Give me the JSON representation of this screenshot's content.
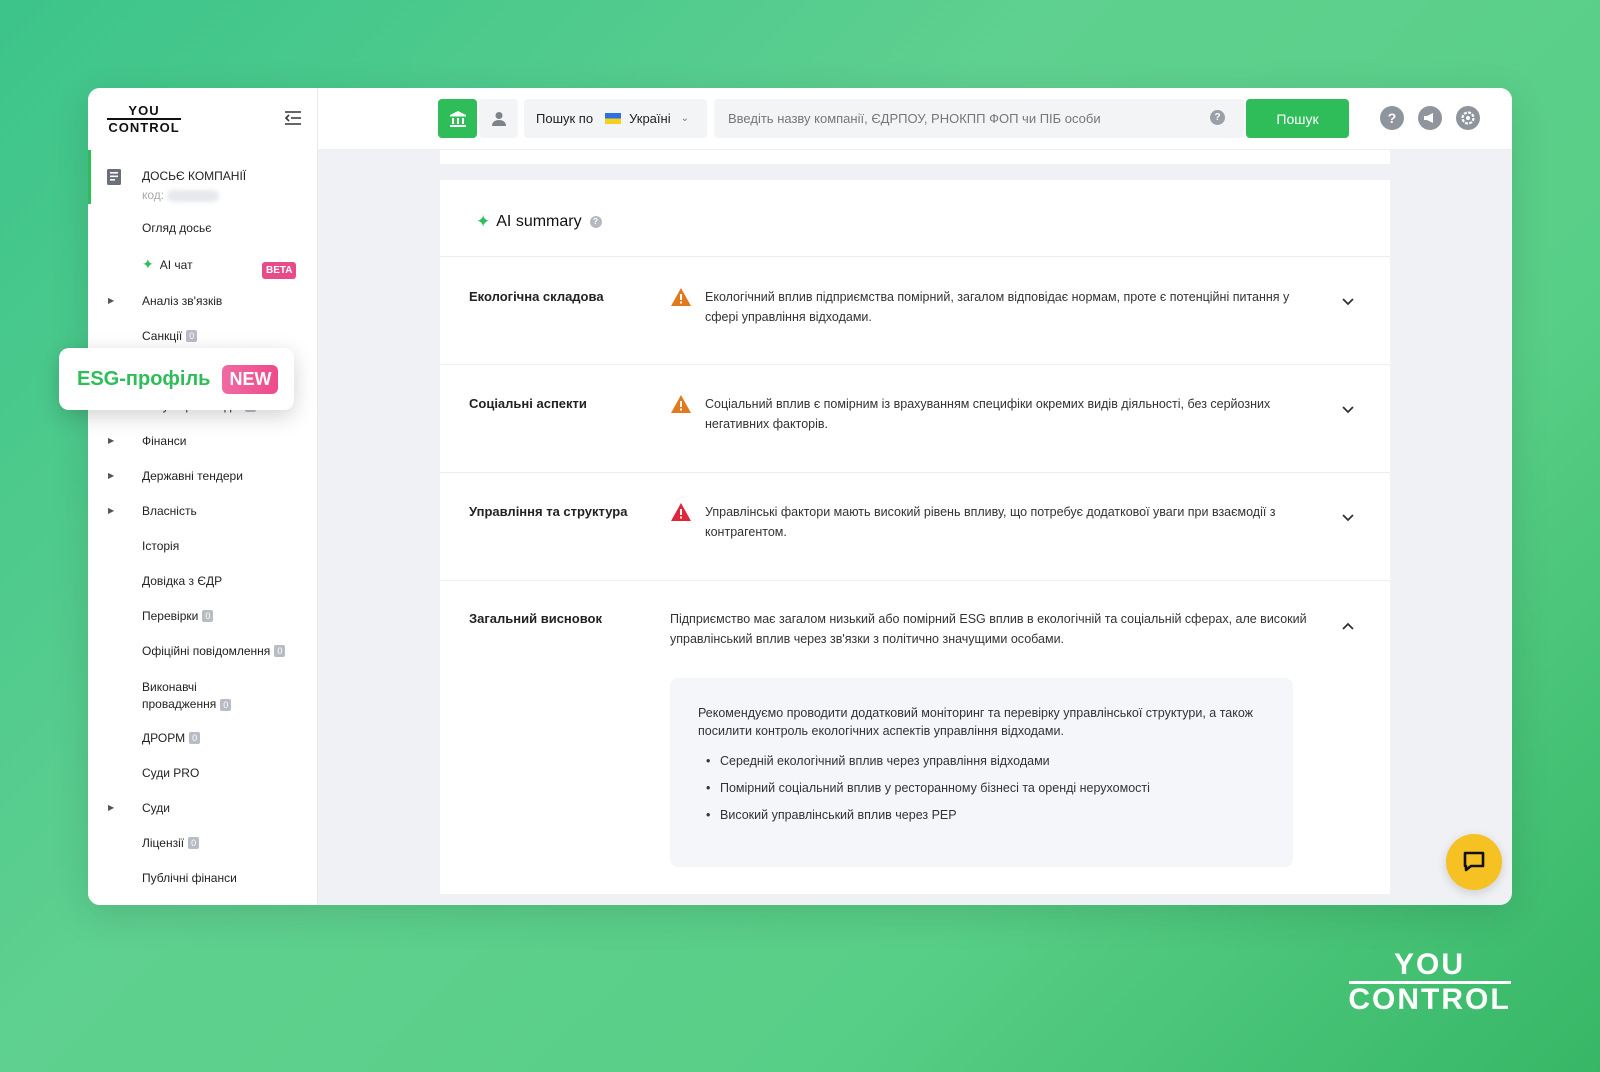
{
  "logo": {
    "line1": "YOU",
    "line2": "CONTROL"
  },
  "sidebar": {
    "dossier_title": "ДОСЬЄ КОМПАНІЇ",
    "dossier_code_label": "код:",
    "items": [
      {
        "label": "Огляд досьє",
        "count": null
      },
      {
        "label": "AI чат",
        "badge": "BETA"
      },
      {
        "label": "Аналіз зв'язків",
        "count": null
      },
      {
        "label": "Санкції",
        "count": "0"
      },
      {
        "label": "Репутація в медіа",
        "count": "0"
      },
      {
        "label": "Фінанси",
        "count": null
      },
      {
        "label": "Державні тендери",
        "count": null
      },
      {
        "label": "Власність",
        "count": null
      },
      {
        "label": "Історія",
        "count": null
      },
      {
        "label": "Довідка з ЄДР",
        "count": null
      },
      {
        "label": "Перевірки",
        "count": "0"
      },
      {
        "label": "Офіційні повідомлення",
        "count": "0"
      },
      {
        "label": "Виконавчі",
        "label2": "провадження",
        "count": "0"
      },
      {
        "label": "ДРОРМ",
        "count": "0"
      },
      {
        "label": "Суди PRO",
        "count": null
      },
      {
        "label": "Суди",
        "count": null
      },
      {
        "label": "Ліцензії",
        "count": "0"
      },
      {
        "label": "Публічні фінанси",
        "count": null
      }
    ]
  },
  "callout": {
    "label": "ESG-профіль",
    "badge": "NEW"
  },
  "header": {
    "scope_prefix": "Пошук по",
    "scope_value": "Україні",
    "search_placeholder": "Введіть назву компанії, ЄДРПОУ, РНОКПП ФОП чи ПІБ особи",
    "search_button": "Пошук"
  },
  "summary": {
    "title": "AI summary",
    "rows": [
      {
        "label": "Екологічна складова",
        "text": "Екологічний вплив підприємства помірний, загалом відповідає нормам, проте є потенційні питання у сфері управління відходами.",
        "level": "medium"
      },
      {
        "label": "Соціальні аспекти",
        "text": "Соціальний вплив є помірним із врахуванням специфіки окремих видів діяльності, без серйозних негативних факторів.",
        "level": "medium"
      },
      {
        "label": "Управління та структура",
        "text": "Управлінські фактори мають високий рівень впливу, що потребує додаткової уваги при взаємодії з контрагентом.",
        "level": "high"
      }
    ],
    "conclusion": {
      "label": "Загальний висновок",
      "text": "Підприємство має загалом низький або помірний ESG вплив в екологічній та соціальній сферах, але високий управлінський вплив через зв'язки з політично значущими особами.",
      "recommendation": "Рекомендуємо проводити додатковий моніторинг та перевірку управлінської структури, а також посилити контроль екологічних аспектів управління відходами.",
      "bullets": [
        "Середній екологічний вплив через управління відходами",
        "Помірний соціальний вплив у ресторанному бізнесі та оренді нерухомості",
        "Високий управлінський вплив через PEP"
      ]
    }
  },
  "colors": {
    "accent": "#2ebd59",
    "warning_medium": "#e07a1f",
    "warning_high": "#e0263a",
    "beta": "#e84b8a",
    "chat": "#f6c122"
  },
  "brand": {
    "line1": "YOU",
    "line2": "CONTROL"
  }
}
